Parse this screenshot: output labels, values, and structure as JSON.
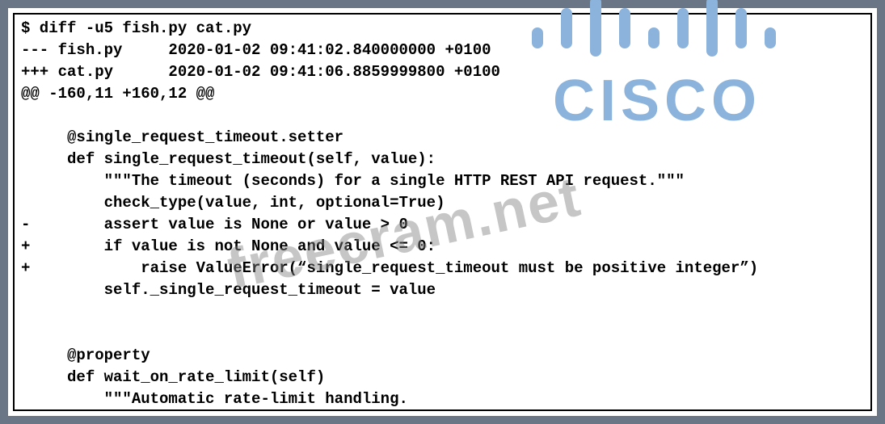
{
  "diff": {
    "command": "$ diff -u5 fish.py cat.py",
    "header_old": "--- fish.py     2020-01-02 09:41:02.840000000 +0100",
    "header_new": "+++ cat.py      2020-01-02 09:41:06.8859999800 +0100",
    "hunk": "@@ -160,11 +160,12 @@",
    "blank1": "",
    "line_decorator": "     @single_request_timeout.setter",
    "line_def": "     def single_request_timeout(self, value):",
    "line_docstring": "         \"\"\"The timeout (seconds) for a single HTTP REST API request.\"\"\"",
    "line_check": "         check_type(value, int, optional=True)",
    "line_removed": "-        assert value is None or value > 0",
    "line_added1": "+        if value is not None and value <= 0:",
    "line_added2": "+            raise ValueError(“single_request_timeout must be positive integer”)",
    "line_assign": "         self._single_request_timeout = value",
    "blank2": "",
    "blank3": "",
    "line_property": "     @property",
    "line_def2": "     def wait_on_rate_limit(self)",
    "line_docstring2": "         \"\"\"Automatic rate-limit handling."
  },
  "logo_text": "CISCO",
  "watermark_text": "freecram.net"
}
